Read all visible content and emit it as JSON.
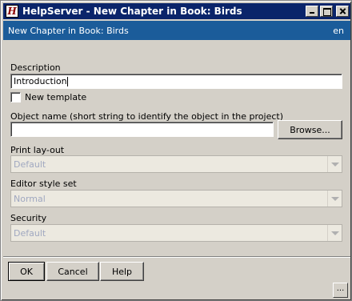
{
  "window": {
    "title": "HelpServer - New Chapter in Book: Birds",
    "icon_glyph": "H"
  },
  "header": {
    "title": "New Chapter in Book: Birds",
    "language": "en"
  },
  "form": {
    "description_label": "Description",
    "description_value": "Introduction",
    "new_template_label": "New template",
    "new_template_checked": false,
    "object_name_label": "Object name (short string to identify the object in the project)",
    "object_name_value": "",
    "browse_label": "Browse...",
    "print_layout_label": "Print lay-out",
    "print_layout_value": "Default",
    "editor_style_label": "Editor style set",
    "editor_style_value": "Normal",
    "security_label": "Security",
    "security_value": "Default"
  },
  "buttons": {
    "ok": "OK",
    "cancel": "Cancel",
    "help": "Help"
  },
  "statusbar": {
    "more_label": "..."
  },
  "colors": {
    "titlebar": "#0a246a",
    "header_band": "#1b5c9a",
    "dialog_bg": "#d4d0c8"
  }
}
